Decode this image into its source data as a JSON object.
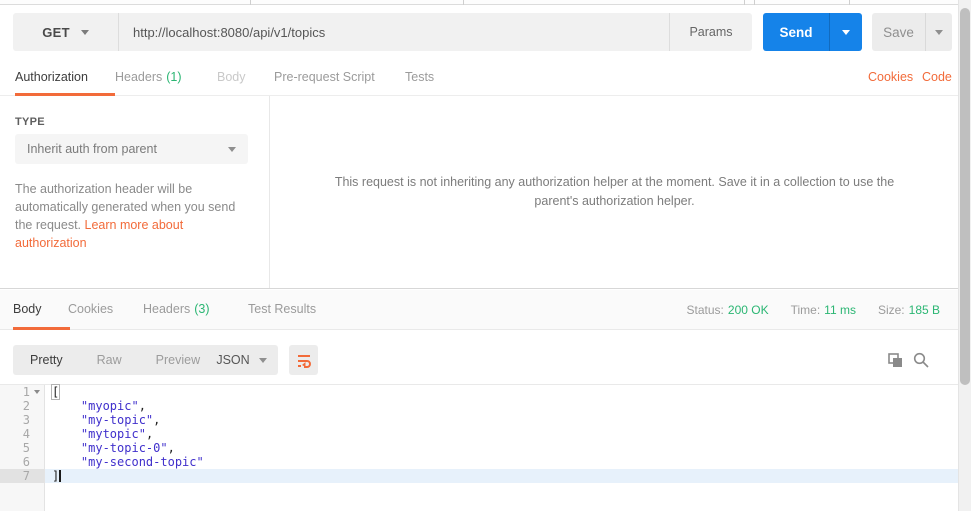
{
  "request": {
    "method": "GET",
    "url": "http://localhost:8080/api/v1/topics",
    "params_label": "Params",
    "send_label": "Send",
    "save_label": "Save",
    "tabs": [
      {
        "label": "Authorization"
      },
      {
        "label": "Headers",
        "badge": "(1)"
      },
      {
        "label": "Body"
      },
      {
        "label": "Pre-request Script"
      },
      {
        "label": "Tests"
      }
    ],
    "links": {
      "cookies": "Cookies",
      "code": "Code"
    }
  },
  "auth": {
    "type_label": "TYPE",
    "type_value": "Inherit auth from parent",
    "help_text": "The authorization header will be automatically generated when you send the request. ",
    "help_link": "Learn more about authorization",
    "inherit_message": "This request is not inheriting any authorization helper at the moment. Save it in a collection to use the parent's authorization helper."
  },
  "response": {
    "tabs": [
      {
        "label": "Body"
      },
      {
        "label": "Cookies"
      },
      {
        "label": "Headers",
        "badge": "(3)"
      },
      {
        "label": "Test Results"
      }
    ],
    "status": {
      "label": "Status:",
      "value": "200 OK"
    },
    "time": {
      "label": "Time:",
      "value": "11 ms"
    },
    "size": {
      "label": "Size:",
      "value": "185 B"
    },
    "view_modes": [
      "Pretty",
      "Raw",
      "Preview"
    ],
    "format": "JSON",
    "body_lines": [
      {
        "num": "1",
        "fold": true,
        "tokens": [
          {
            "t": "pm",
            "v": "["
          }
        ]
      },
      {
        "num": "2",
        "tokens": [
          {
            "t": "ws",
            "v": "    "
          },
          {
            "t": "str",
            "v": "\"myopic\""
          },
          {
            "t": "p",
            "v": ","
          }
        ]
      },
      {
        "num": "3",
        "tokens": [
          {
            "t": "ws",
            "v": "    "
          },
          {
            "t": "str",
            "v": "\"my-topic\""
          },
          {
            "t": "p",
            "v": ","
          }
        ]
      },
      {
        "num": "4",
        "tokens": [
          {
            "t": "ws",
            "v": "    "
          },
          {
            "t": "str",
            "v": "\"mytopic\""
          },
          {
            "t": "p",
            "v": ","
          }
        ]
      },
      {
        "num": "5",
        "tokens": [
          {
            "t": "ws",
            "v": "    "
          },
          {
            "t": "str",
            "v": "\"my-topic-0\""
          },
          {
            "t": "p",
            "v": ","
          }
        ]
      },
      {
        "num": "6",
        "tokens": [
          {
            "t": "ws",
            "v": "    "
          },
          {
            "t": "str",
            "v": "\"my-second-topic\""
          }
        ]
      },
      {
        "num": "7",
        "active": true,
        "cursor": true,
        "tokens": [
          {
            "t": "p",
            "v": "]"
          }
        ]
      }
    ]
  },
  "colors": {
    "accent_orange": "#f26b3a",
    "send_blue": "#1583e9",
    "status_green": "#2bb673",
    "json_string": "#4030cc"
  }
}
